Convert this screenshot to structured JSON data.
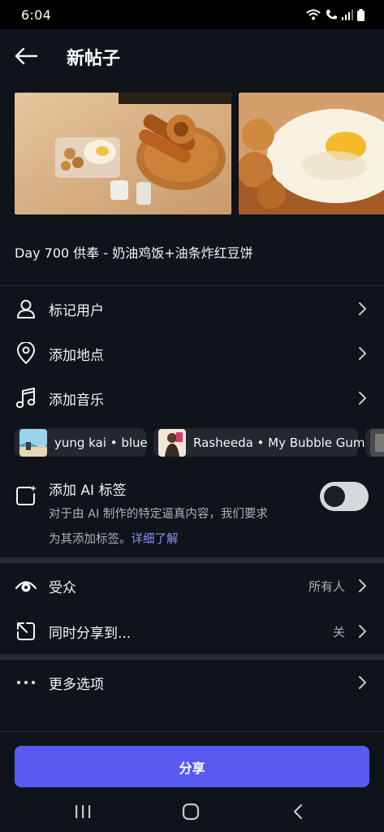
{
  "status": {
    "time": "6:04"
  },
  "header": {
    "title": "新帖子"
  },
  "caption": "Day 700 供奉 - 奶油鸡饭+油条炸红豆饼",
  "menu": {
    "tag_users": "标记用户",
    "add_location": "添加地点",
    "add_music": "添加音乐"
  },
  "music_suggestions": [
    {
      "label": "yung kai • blue"
    },
    {
      "label": "Rasheeda • My Bubble Gum"
    }
  ],
  "ai_label": {
    "title": "添加 AI 标签",
    "desc_line1": "对于由 AI 制作的特定逼真内容，我们要求",
    "desc_line2": "为其添加标签。",
    "link": "详细了解",
    "enabled": false
  },
  "audience": {
    "label": "受众",
    "value": "所有人"
  },
  "share_to": {
    "label": "同时分享到...",
    "value": "关"
  },
  "more_options": {
    "label": "更多选项"
  },
  "share_button": "分享",
  "colors": {
    "background": "#0f141b",
    "accent": "#585af2",
    "link": "#8a8ffb",
    "secondary_text": "#a9b0ba"
  },
  "icons": [
    "back-arrow-icon",
    "person-icon",
    "location-pin-icon",
    "music-note-icon",
    "ai-label-icon",
    "eye-icon",
    "share-arrow-icon",
    "more-dots-icon",
    "chevron-right-icon"
  ]
}
